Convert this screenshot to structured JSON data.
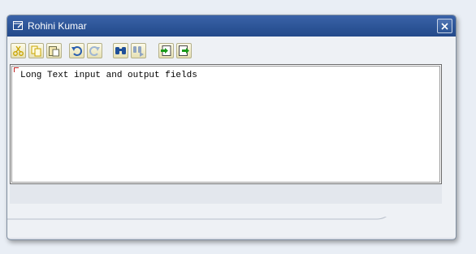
{
  "window": {
    "title": "Rohini Kumar",
    "title_icon": "edit-window-icon",
    "close_icon": "close-icon"
  },
  "toolbar": {
    "buttons": [
      {
        "name": "cut-icon"
      },
      {
        "name": "copy-icon"
      },
      {
        "name": "paste-icon"
      },
      {
        "name": "undo-icon"
      },
      {
        "name": "redo-icon"
      },
      {
        "name": "find-icon"
      },
      {
        "name": "find-next-icon"
      },
      {
        "name": "import-icon"
      },
      {
        "name": "export-icon"
      }
    ]
  },
  "editor": {
    "content": "Long Text input and output fields"
  },
  "colors": {
    "titlebar": "#2c5497",
    "accent": "#3b63a8"
  }
}
